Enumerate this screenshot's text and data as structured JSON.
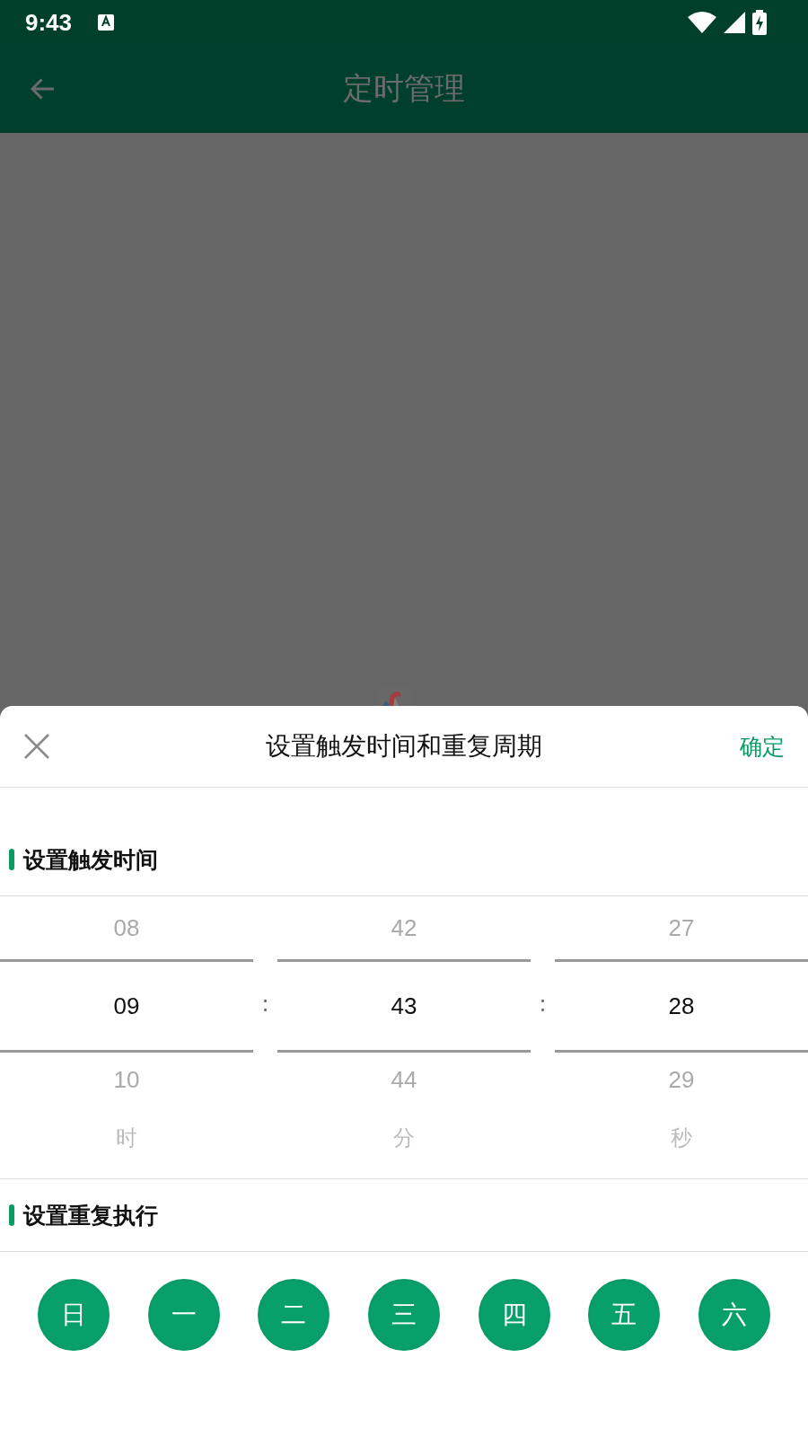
{
  "status_bar": {
    "time": "9:43"
  },
  "app_bar": {
    "title": "定时管理"
  },
  "sheet": {
    "title": "设置触发时间和重复周期",
    "confirm": "确定"
  },
  "time_section": {
    "heading": "设置触发时间",
    "pickers": [
      {
        "unit": "时",
        "items": [
          {
            "label": "08",
            "selected": false
          },
          {
            "label": "09",
            "selected": true
          },
          {
            "label": "10",
            "selected": false
          }
        ]
      },
      {
        "unit": "分",
        "items": [
          {
            "label": "42",
            "selected": false
          },
          {
            "label": "43",
            "selected": true
          },
          {
            "label": "44",
            "selected": false
          }
        ]
      },
      {
        "unit": "秒",
        "items": [
          {
            "label": "27",
            "selected": false
          },
          {
            "label": "28",
            "selected": true
          },
          {
            "label": "29",
            "selected": false
          }
        ]
      }
    ],
    "separators": [
      ":",
      ":"
    ]
  },
  "repeat_section": {
    "heading": "设置重复执行",
    "days": [
      {
        "label": "日",
        "selected": true
      },
      {
        "label": "一",
        "selected": true
      },
      {
        "label": "二",
        "selected": true
      },
      {
        "label": "三",
        "selected": true
      },
      {
        "label": "四",
        "selected": true
      },
      {
        "label": "五",
        "selected": true
      },
      {
        "label": "六",
        "selected": true
      }
    ]
  }
}
